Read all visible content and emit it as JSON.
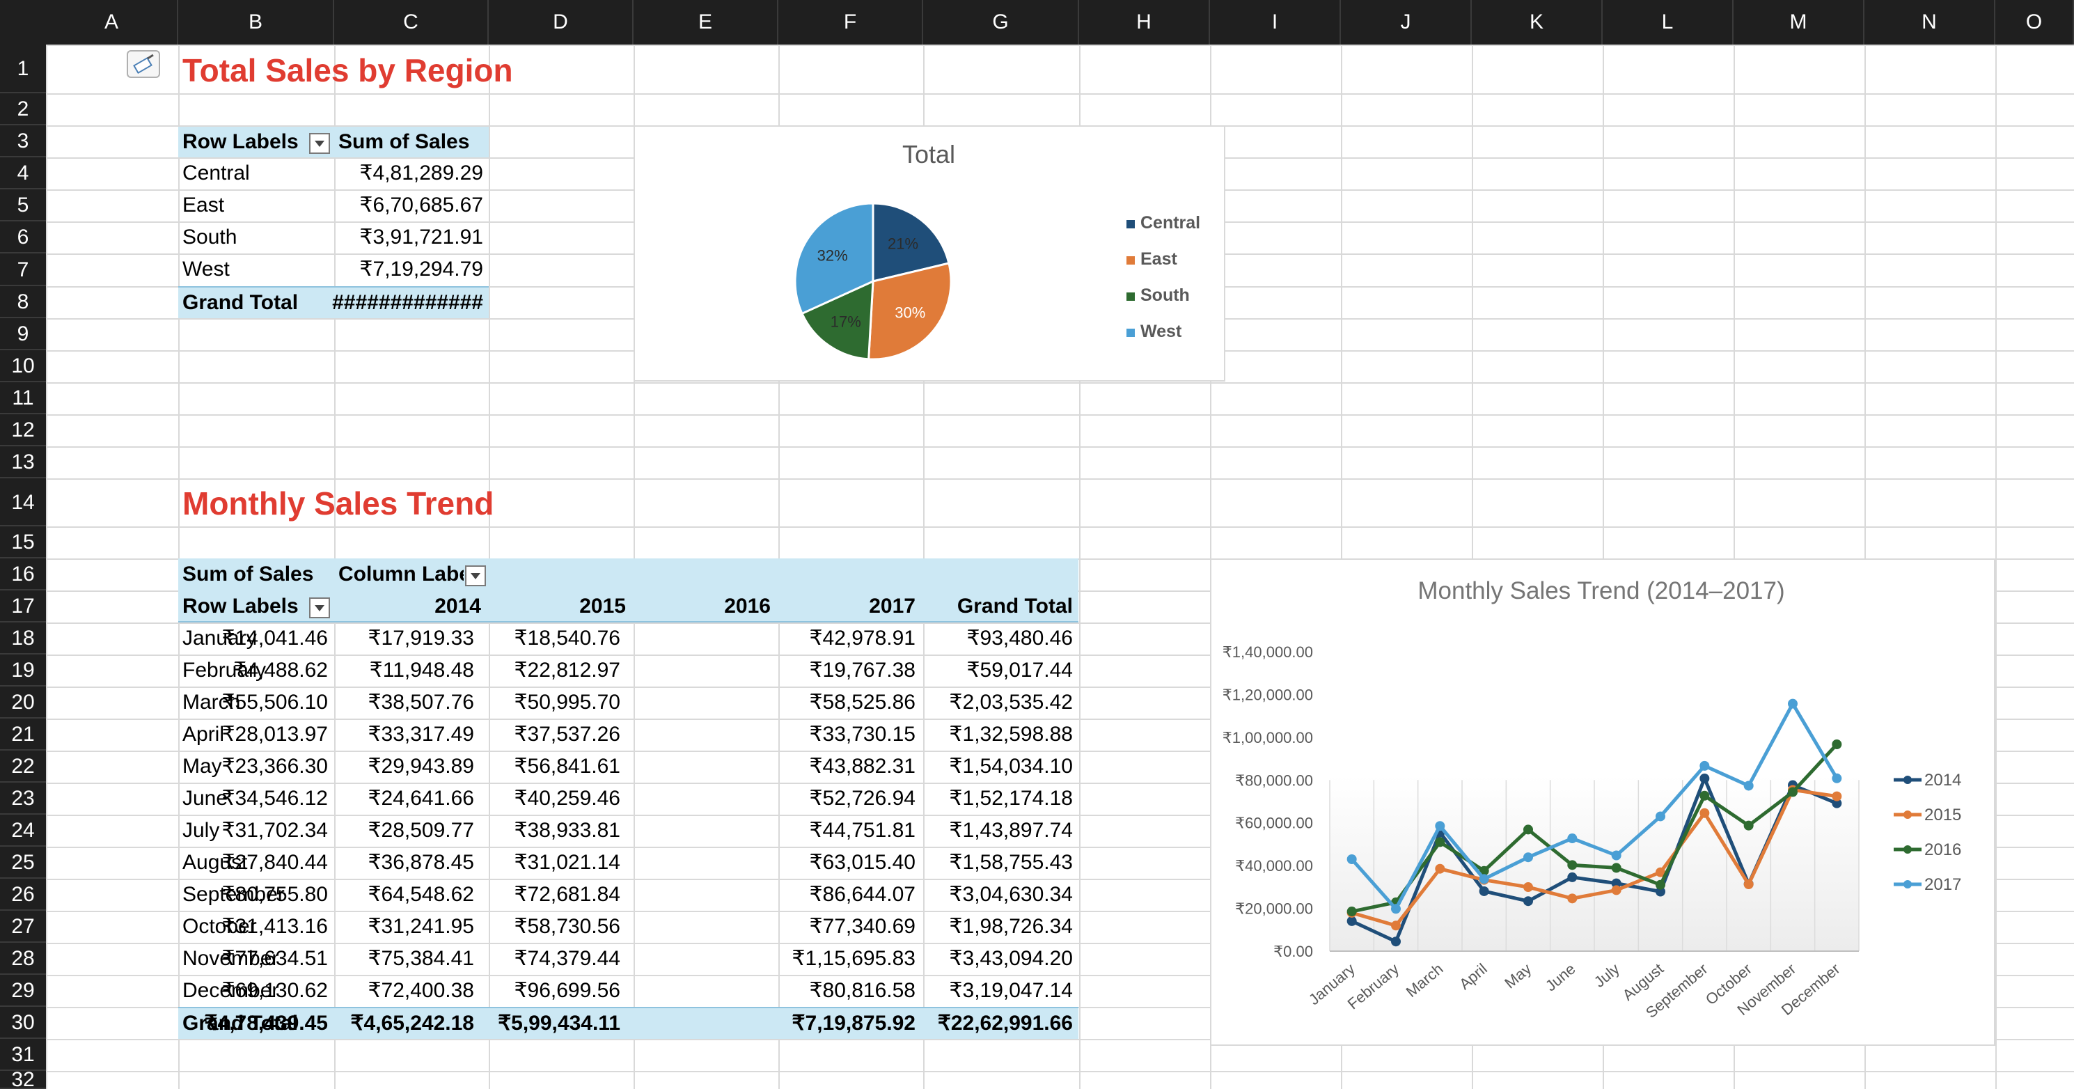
{
  "columns": [
    "A",
    "B",
    "C",
    "D",
    "E",
    "F",
    "G",
    "H",
    "I",
    "J",
    "K",
    "L",
    "M",
    "N",
    "O"
  ],
  "rows": [
    "1",
    "2",
    "3",
    "4",
    "5",
    "6",
    "7",
    "8",
    "9",
    "10",
    "11",
    "12",
    "13",
    "14",
    "15",
    "16",
    "17",
    "18",
    "19",
    "20",
    "21",
    "22",
    "23",
    "24",
    "25",
    "26",
    "27",
    "28",
    "29",
    "30",
    "31",
    "32"
  ],
  "section1": {
    "title": "Total Sales by Region",
    "header": {
      "row_labels": "Row Labels",
      "sum_of_sales": "Sum of Sales"
    },
    "rows": [
      {
        "label": "Central",
        "value": "₹4,81,289.29"
      },
      {
        "label": "East",
        "value": "₹6,70,685.67"
      },
      {
        "label": "South",
        "value": "₹3,91,721.91"
      },
      {
        "label": "West",
        "value": "₹7,19,294.79"
      }
    ],
    "grand_total": {
      "label": "Grand Total",
      "value": "#############"
    }
  },
  "section2": {
    "title": "Monthly Sales Trend",
    "header1": {
      "sum_of_sales": "Sum of Sales",
      "column_labels": "Column Labe"
    },
    "header2": {
      "row_labels": "Row Labels",
      "y2014": "2014",
      "y2015": "2015",
      "y2016": "2016",
      "y2017": "2017",
      "grand_total": "Grand Total"
    },
    "rows": [
      {
        "month": "January",
        "y2014": "₹14,041.46",
        "y2015": "₹17,919.33",
        "y2016": "₹18,540.76",
        "y2017": "₹42,978.91",
        "total": "₹93,480.46"
      },
      {
        "month": "February",
        "y2014": "₹4,488.62",
        "y2015": "₹11,948.48",
        "y2016": "₹22,812.97",
        "y2017": "₹19,767.38",
        "total": "₹59,017.44"
      },
      {
        "month": "March",
        "y2014": "₹55,506.10",
        "y2015": "₹38,507.76",
        "y2016": "₹50,995.70",
        "y2017": "₹58,525.86",
        "total": "₹2,03,535.42"
      },
      {
        "month": "April",
        "y2014": "₹28,013.97",
        "y2015": "₹33,317.49",
        "y2016": "₹37,537.26",
        "y2017": "₹33,730.15",
        "total": "₹1,32,598.88"
      },
      {
        "month": "May",
        "y2014": "₹23,366.30",
        "y2015": "₹29,943.89",
        "y2016": "₹56,841.61",
        "y2017": "₹43,882.31",
        "total": "₹1,54,034.10"
      },
      {
        "month": "June",
        "y2014": "₹34,546.12",
        "y2015": "₹24,641.66",
        "y2016": "₹40,259.46",
        "y2017": "₹52,726.94",
        "total": "₹1,52,174.18"
      },
      {
        "month": "July",
        "y2014": "₹31,702.34",
        "y2015": "₹28,509.77",
        "y2016": "₹38,933.81",
        "y2017": "₹44,751.81",
        "total": "₹1,43,897.74"
      },
      {
        "month": "August",
        "y2014": "₹27,840.44",
        "y2015": "₹36,878.45",
        "y2016": "₹31,021.14",
        "y2017": "₹63,015.40",
        "total": "₹1,58,755.43"
      },
      {
        "month": "September",
        "y2014": "₹80,755.80",
        "y2015": "₹64,548.62",
        "y2016": "₹72,681.84",
        "y2017": "₹86,644.07",
        "total": "₹3,04,630.34"
      },
      {
        "month": "October",
        "y2014": "₹31,413.16",
        "y2015": "₹31,241.95",
        "y2016": "₹58,730.56",
        "y2017": "₹77,340.69",
        "total": "₹1,98,726.34"
      },
      {
        "month": "November",
        "y2014": "₹77,634.51",
        "y2015": "₹75,384.41",
        "y2016": "₹74,379.44",
        "y2017": "₹1,15,695.83",
        "total": "₹3,43,094.20"
      },
      {
        "month": "December",
        "y2014": "₹69,130.62",
        "y2015": "₹72,400.38",
        "y2016": "₹96,699.56",
        "y2017": "₹80,816.58",
        "total": "₹3,19,047.14"
      }
    ],
    "grand_total": {
      "label": "Grand Total",
      "y2014": "₹4,78,439.45",
      "y2015": "₹4,65,242.18",
      "y2016": "₹5,99,434.11",
      "y2017": "₹7,19,875.92",
      "total": "₹22,62,991.66"
    }
  },
  "chart_data": [
    {
      "type": "pie",
      "title": "Total",
      "categories": [
        "Central",
        "East",
        "South",
        "West"
      ],
      "values": [
        481289.29,
        670685.67,
        391721.91,
        719294.79
      ],
      "data_labels": [
        "21%",
        "30%",
        "17%",
        "32%"
      ],
      "colors": [
        "#1f4e79",
        "#e07b39",
        "#2e6b30",
        "#4a9fd5"
      ],
      "legend": "right"
    },
    {
      "type": "line",
      "title": "Monthly Sales Trend (2014–2017)",
      "categories": [
        "January",
        "February",
        "March",
        "April",
        "May",
        "June",
        "July",
        "August",
        "September",
        "October",
        "November",
        "December"
      ],
      "series": [
        {
          "name": "2014",
          "color": "#1f4e79",
          "values": [
            14041.46,
            4488.62,
            55506.1,
            28013.97,
            23366.3,
            34546.12,
            31702.34,
            27840.44,
            80755.8,
            31413.16,
            77634.51,
            69130.62
          ]
        },
        {
          "name": "2015",
          "color": "#e07b39",
          "values": [
            17919.33,
            11948.48,
            38507.76,
            33317.49,
            29943.89,
            24641.66,
            28509.77,
            36878.45,
            64548.62,
            31241.95,
            75384.41,
            72400.38
          ]
        },
        {
          "name": "2016",
          "color": "#2e6b30",
          "values": [
            18540.76,
            22812.97,
            50995.7,
            37537.26,
            56841.61,
            40259.46,
            38933.81,
            31021.14,
            72681.84,
            58730.56,
            74379.44,
            96699.56
          ]
        },
        {
          "name": "2017",
          "color": "#4a9fd5",
          "values": [
            42978.91,
            19767.38,
            58525.86,
            33730.15,
            43882.31,
            52726.94,
            44751.81,
            63015.4,
            86644.07,
            77340.69,
            115695.83,
            80816.58
          ]
        }
      ],
      "ylim": [
        0,
        140000
      ],
      "y_tick_labels": [
        "₹0.00",
        "₹20,000.00",
        "₹40,000.00",
        "₹60,000.00",
        "₹80,000.00",
        "₹1,00,000.00",
        "₹1,20,000.00",
        "₹1,40,000.00"
      ],
      "legend": "right"
    }
  ]
}
